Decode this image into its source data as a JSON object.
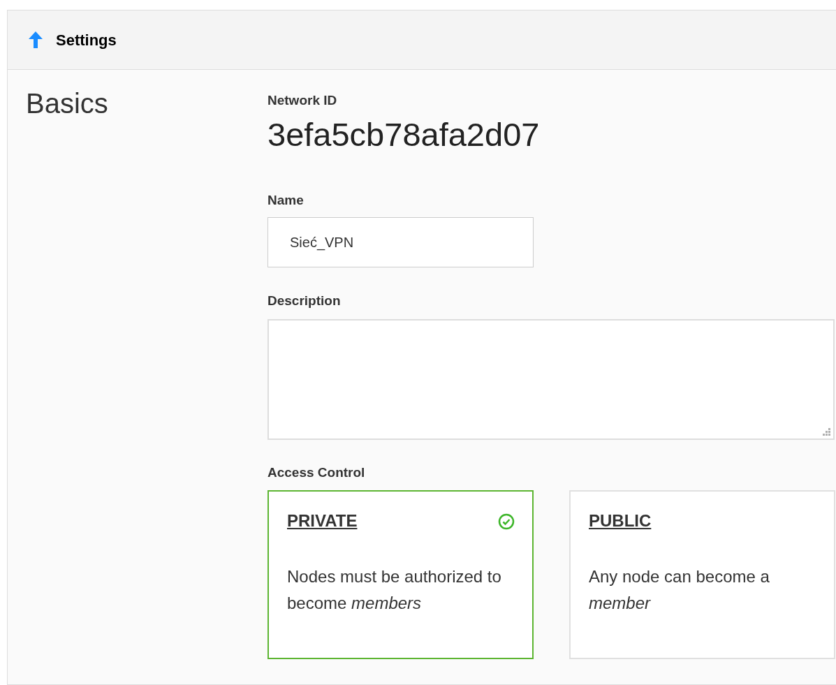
{
  "header": {
    "title": "Settings"
  },
  "section": {
    "title": "Basics"
  },
  "network_id": {
    "label": "Network ID",
    "value": "3efa5cb78afa2d07"
  },
  "name": {
    "label": "Name",
    "value": "Sieć_VPN"
  },
  "description": {
    "label": "Description"
  },
  "access_control": {
    "label": "Access Control",
    "options": [
      {
        "title": "PRIVATE",
        "text": "Nodes must be authorized to become *members*",
        "selected": true
      },
      {
        "title": "PUBLIC",
        "text": "Any node can become a *member*",
        "selected": false
      }
    ]
  }
}
